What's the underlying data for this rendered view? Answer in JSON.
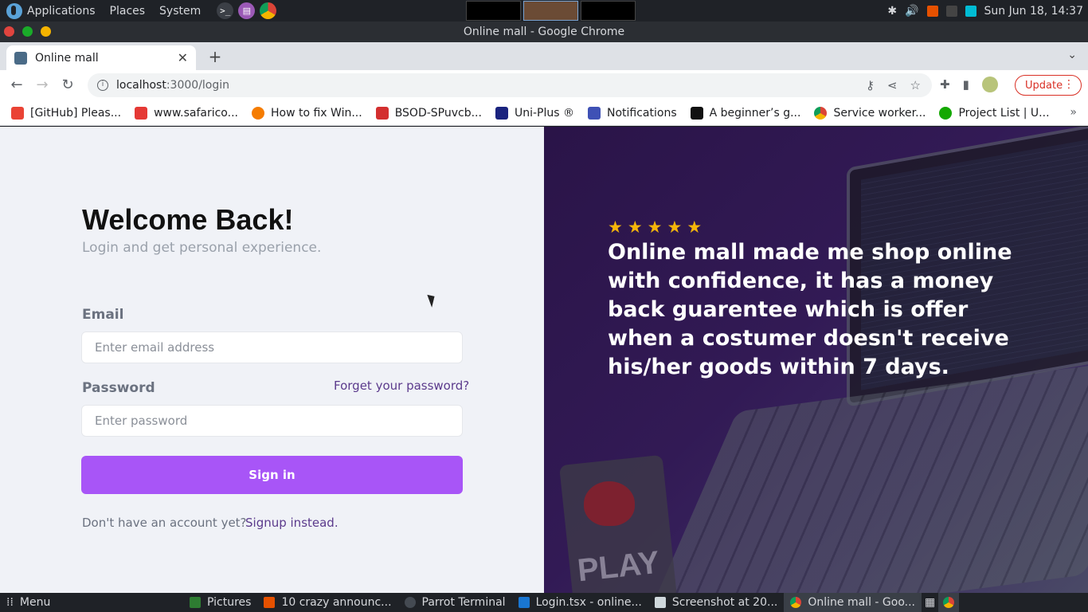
{
  "top_panel": {
    "menus": [
      "Applications",
      "Places",
      "System"
    ],
    "clock": "Sun Jun 18, 14:37"
  },
  "window": {
    "title": "Online mall - Google Chrome"
  },
  "browser": {
    "tab": {
      "title": "Online mall"
    },
    "url_host": "localhost",
    "url_path": ":3000/login",
    "update_label": "Update",
    "bookmarks": [
      {
        "label": "[GitHub] Pleas...",
        "color": "#ea4335"
      },
      {
        "label": "www.safarico...",
        "color": "#e53935"
      },
      {
        "label": "How to fix Win...",
        "color": "#f57c00"
      },
      {
        "label": "BSOD-SPuvcb...",
        "color": "#d32f2f"
      },
      {
        "label": "Uni-Plus ®",
        "color": "#1a237e"
      },
      {
        "label": "Notifications",
        "color": "#3f51b5"
      },
      {
        "label": "A beginner’s g...",
        "color": "#111111"
      },
      {
        "label": "Service worker...",
        "color": "#4285f4"
      },
      {
        "label": "Project List | U...",
        "color": "#14a800"
      }
    ]
  },
  "login": {
    "title": "Welcome Back!",
    "subtitle": "Login and get personal experience.",
    "email_label": "Email",
    "email_placeholder": "Enter email address",
    "password_label": "Password",
    "forgot_link": "Forget your password?",
    "password_placeholder": "Enter password",
    "signin_label": "Sign in",
    "no_account_text": "Don't have an account yet?",
    "signup_link": "Signup instead."
  },
  "testimonial": {
    "stars": [
      "★",
      "★",
      "★",
      "★",
      "★"
    ],
    "quote": "Online mall made me shop online with confidence, it has a money back guarentee which is offer when a costumer doesn't receive his/her goods within 7 days."
  },
  "taskbar": {
    "menu_label": "Menu",
    "items": [
      {
        "label": "Pictures",
        "color": "#2e7d32"
      },
      {
        "label": "10 crazy announc...",
        "color": "#e65100"
      },
      {
        "label": "Parrot Terminal",
        "color": "#444a52"
      },
      {
        "label": "Login.tsx - online...",
        "color": "#1976d2"
      },
      {
        "label": "Screenshot at 20...",
        "color": "#cfd8dc"
      },
      {
        "label": "Online mall - Goo...",
        "color": "#f4b400"
      }
    ]
  },
  "colors": {
    "accent": "#a855f7",
    "link": "#5b3a8c",
    "star": "#f5b50a",
    "panel_bg": "#2a1448"
  }
}
